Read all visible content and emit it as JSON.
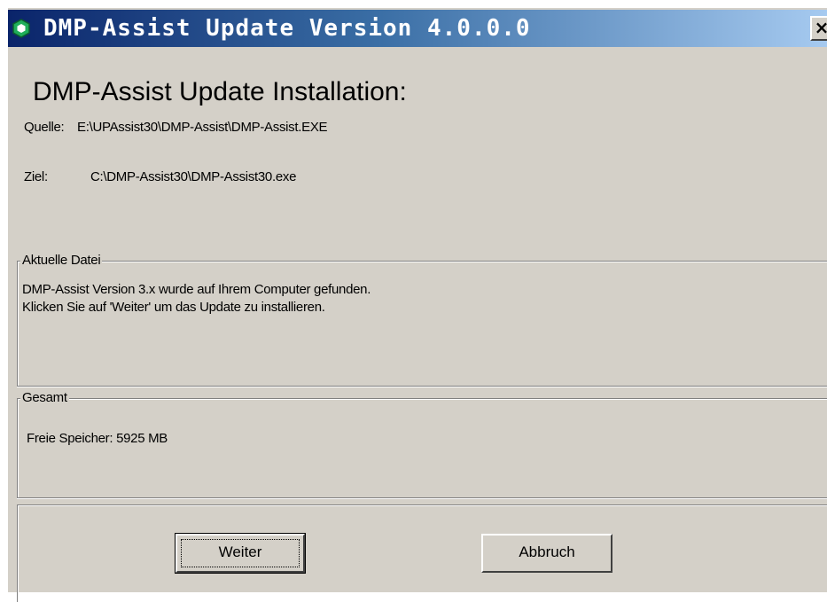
{
  "window": {
    "title": "DMP-Assist Update Version 4.0.0.0",
    "close_glyph": "×",
    "icon": "green-hexagon-icon",
    "accent_color": "#0a246a"
  },
  "main": {
    "heading": "DMP-Assist Update Installation:",
    "source_label": "Quelle:",
    "source_value": "E:\\UPAssist30\\DMP-Assist\\DMP-Assist.EXE",
    "target_label": "Ziel:",
    "target_value": "C:\\DMP-Assist30\\DMP-Assist30.exe"
  },
  "current_file": {
    "legend": "Aktuelle Datei",
    "line1": "DMP-Assist Version 3.x wurde auf Ihrem Computer gefunden.",
    "line2": "Klicken Sie auf 'Weiter' um das Update zu installieren."
  },
  "total": {
    "legend": "Gesamt",
    "free_memory": "Freie Speicher: 5925 MB"
  },
  "buttons": {
    "next_label": "Weiter",
    "cancel_label": "Abbruch"
  }
}
